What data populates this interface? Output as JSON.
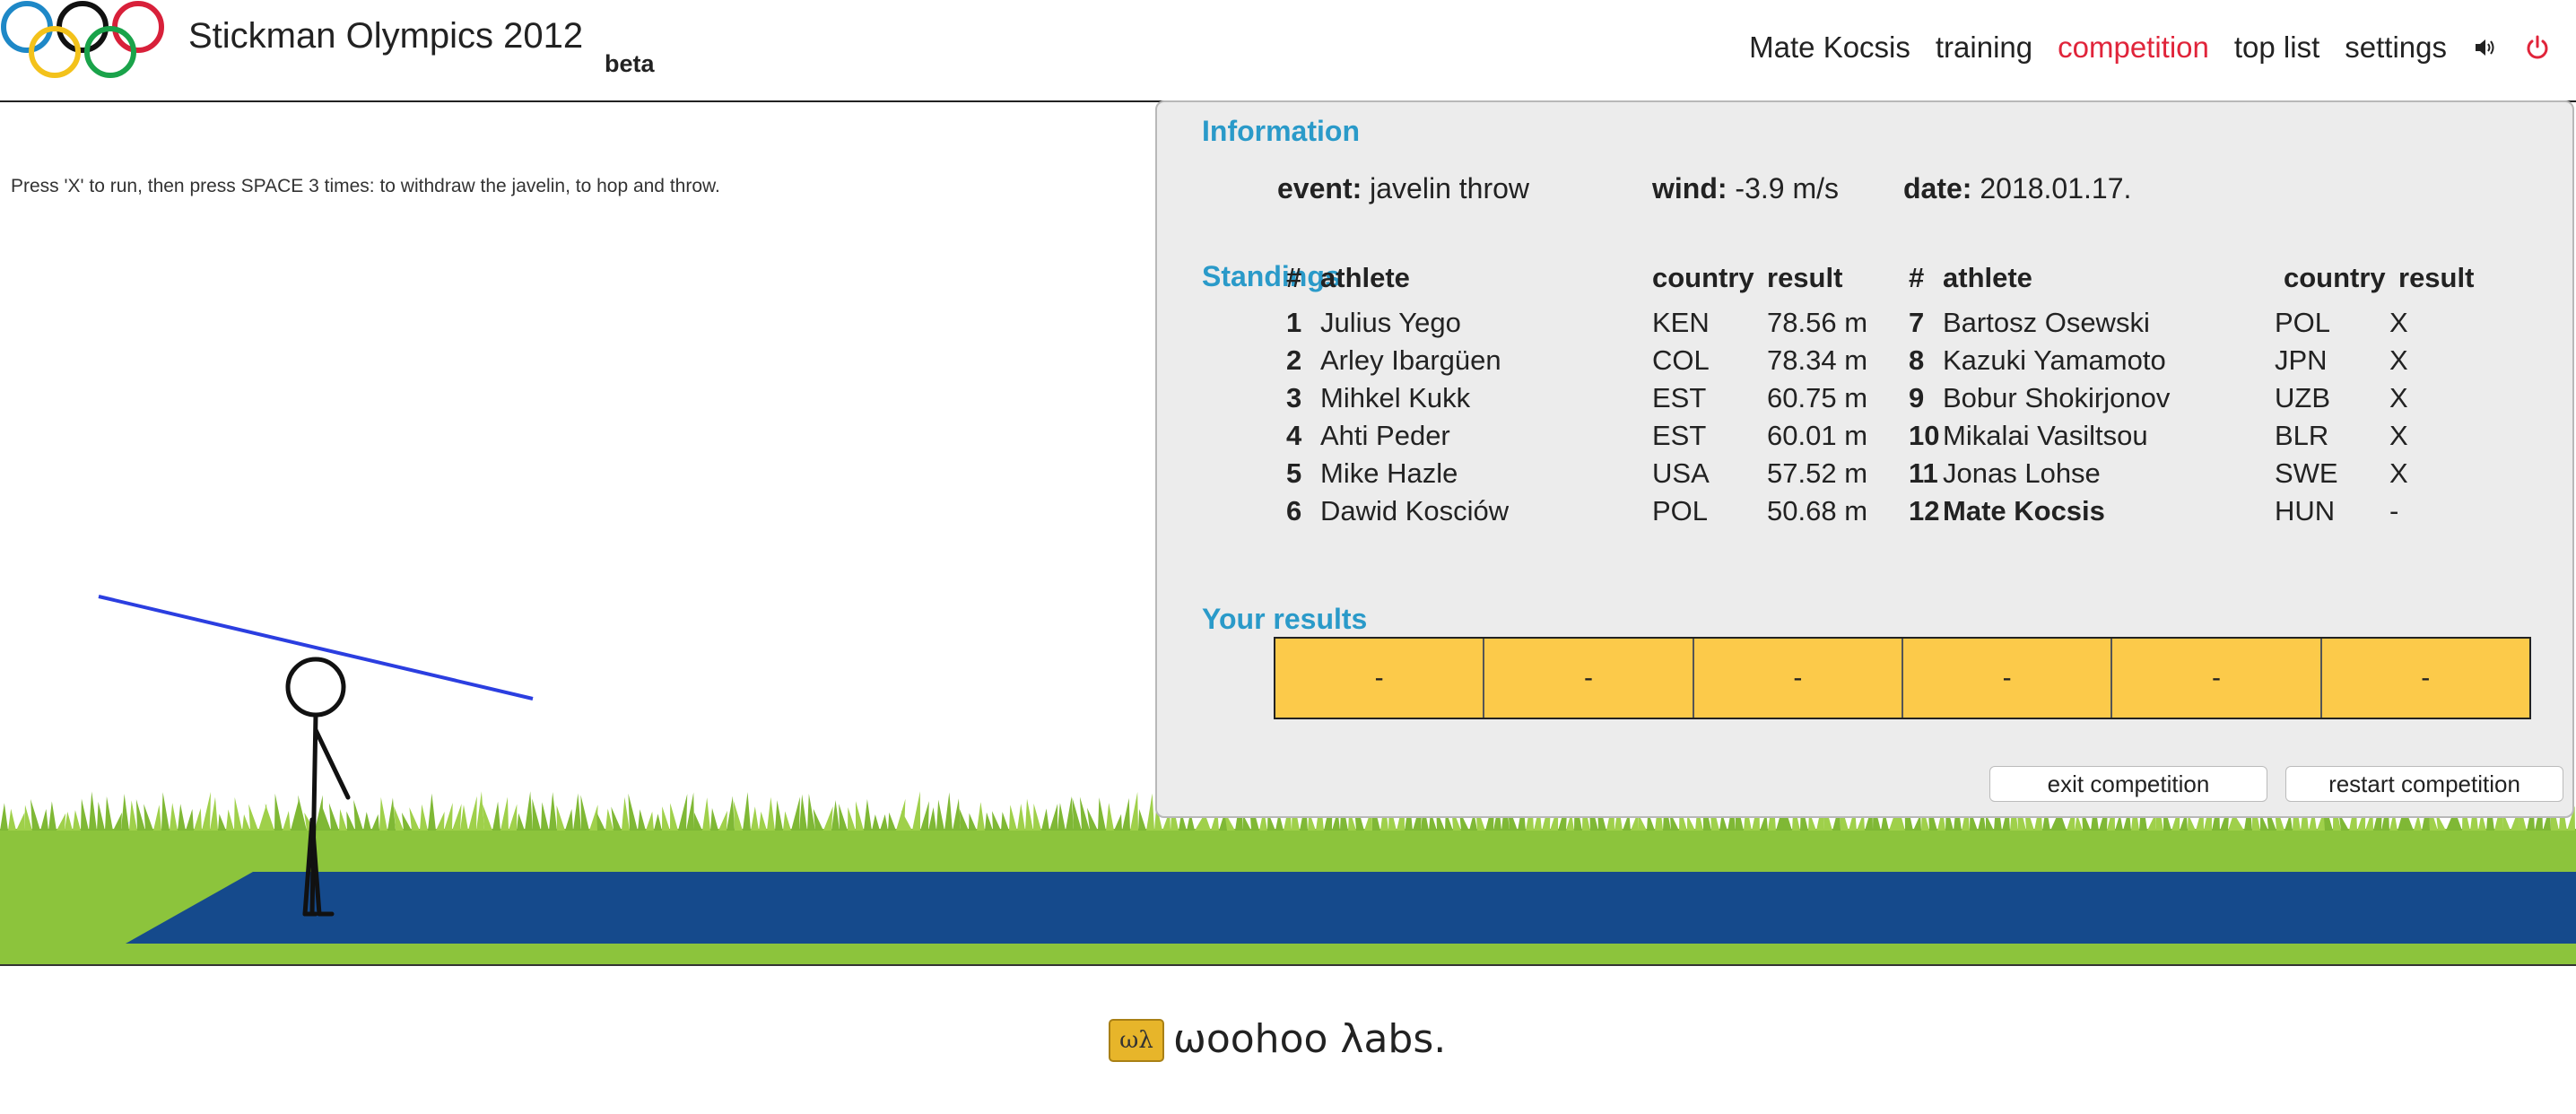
{
  "app": {
    "title": "Stickman Olympics 2012",
    "beta_label": "beta"
  },
  "nav": {
    "items": [
      {
        "label": "Mate Kocsis",
        "active": false
      },
      {
        "label": "training",
        "active": false
      },
      {
        "label": "competition",
        "active": true
      },
      {
        "label": "top list",
        "active": false
      },
      {
        "label": "settings",
        "active": false
      }
    ],
    "sound_icon": "speaker-icon",
    "power_icon": "power-icon"
  },
  "game": {
    "instructions": "Press 'X' to run, then press SPACE 3 times: to withdraw the javelin, to hop and throw."
  },
  "panel": {
    "information_title": "Information",
    "event_label": "event:",
    "event_value": "javelin throw",
    "wind_label": "wind:",
    "wind_value": "-3.9 m/s",
    "date_label": "date:",
    "date_value": "2018.01.17.",
    "standings_title": "Standings",
    "headers": {
      "rank": "#",
      "athlete": "athlete",
      "country": "country",
      "result": "result"
    },
    "standings_left": [
      {
        "rank": "1",
        "athlete": "Julius Yego",
        "country": "KEN",
        "result": "78.56 m"
      },
      {
        "rank": "2",
        "athlete": "Arley Ibargüen",
        "country": "COL",
        "result": "78.34 m"
      },
      {
        "rank": "3",
        "athlete": "Mihkel Kukk",
        "country": "EST",
        "result": "60.75 m"
      },
      {
        "rank": "4",
        "athlete": "Ahti Peder",
        "country": "EST",
        "result": "60.01 m"
      },
      {
        "rank": "5",
        "athlete": "Mike Hazle",
        "country": "USA",
        "result": "57.52 m"
      },
      {
        "rank": "6",
        "athlete": "Dawid Kosciów",
        "country": "POL",
        "result": "50.68 m"
      }
    ],
    "standings_right": [
      {
        "rank": "7",
        "athlete": "Bartosz Osewski",
        "country": "POL",
        "result": "X"
      },
      {
        "rank": "8",
        "athlete": "Kazuki Yamamoto",
        "country": "JPN",
        "result": "X"
      },
      {
        "rank": "9",
        "athlete": "Bobur Shokirjonov",
        "country": "UZB",
        "result": "X"
      },
      {
        "rank": "10",
        "athlete": "Mikalai Vasiltsou",
        "country": "BLR",
        "result": "X"
      },
      {
        "rank": "11",
        "athlete": "Jonas Lohse",
        "country": "SWE",
        "result": "X"
      },
      {
        "rank": "12",
        "athlete": "Mate Kocsis",
        "country": "HUN",
        "result": "-"
      }
    ],
    "your_results_title": "Your results",
    "your_results": [
      "-",
      "-",
      "-",
      "-",
      "-",
      "-"
    ],
    "exit_button": "exit competition",
    "restart_button": "restart competition"
  },
  "footer": {
    "logo_mark": "ωλ",
    "brand": "ωoohoo λabs."
  },
  "colors": {
    "accent": "#2a9ac9",
    "active_nav": "#e0243a",
    "results_fill": "#fcca4a",
    "track": "#154a8c",
    "grass": "#8cc43c",
    "javelin": "#2b3ee0"
  }
}
